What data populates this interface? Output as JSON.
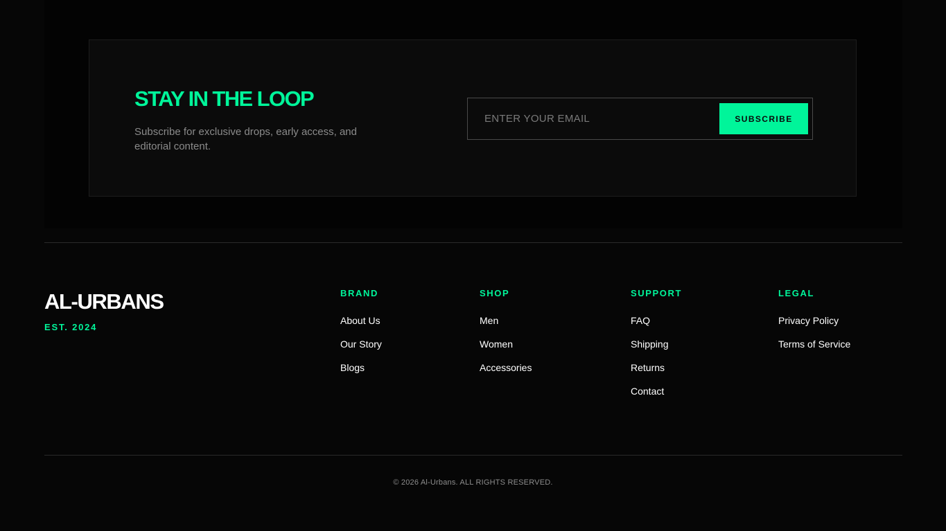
{
  "newsletter": {
    "title": "STAY IN THE LOOP",
    "description": "Subscribe for exclusive drops, early access, and editorial content.",
    "email_placeholder": "ENTER YOUR EMAIL",
    "email_value": "",
    "subscribe_label": "SUBSCRIBE"
  },
  "brand": {
    "name": "AL-URBANS",
    "tagline": "EST. 2024"
  },
  "footer": {
    "columns": [
      {
        "heading": "BRAND",
        "links": [
          "About Us",
          "Our Story",
          "Blogs"
        ]
      },
      {
        "heading": "SHOP",
        "links": [
          "Men",
          "Women",
          "Accessories"
        ]
      },
      {
        "heading": "SUPPORT",
        "links": [
          "FAQ",
          "Shipping",
          "Returns",
          "Contact"
        ]
      },
      {
        "heading": "LEGAL",
        "links": [
          "Privacy Policy",
          "Terms of Service"
        ]
      }
    ],
    "copyright": "© 2026 Al-Urbans. ALL RIGHTS RESERVED."
  },
  "colors": {
    "accent": "#00f59a",
    "background": "#060606",
    "panel": "#0b0b0b",
    "text": "#ffffff",
    "muted": "#8b8b8b"
  }
}
